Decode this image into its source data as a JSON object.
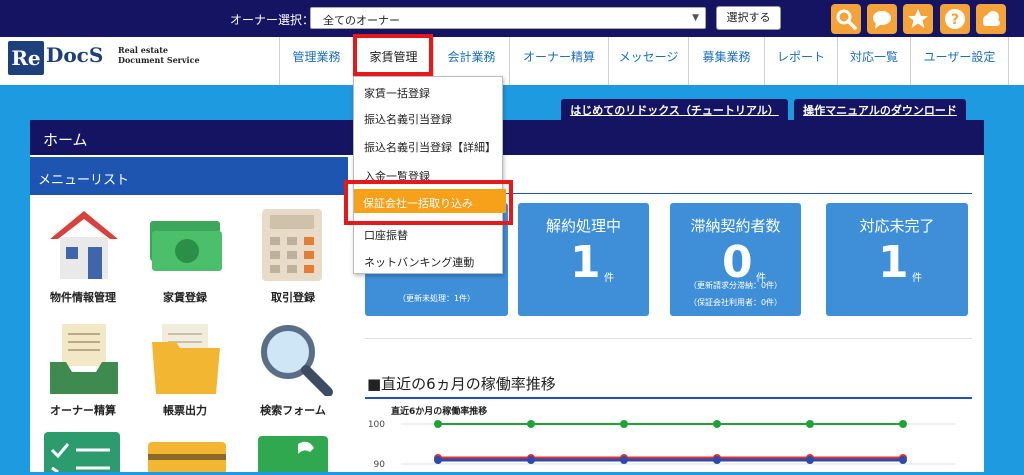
{
  "topbar": {
    "owner_label": "オーナー選択：",
    "owner_value": "全てのオーナー",
    "select_button": "選択する",
    "icons": [
      "search-icon",
      "chat-icon",
      "star-icon",
      "help-icon",
      "cloud-icon"
    ]
  },
  "logo": {
    "re": "Re",
    "docs": "DocS",
    "tagline_line1": "Real estate",
    "tagline_line2": "Document Service"
  },
  "nav": {
    "items": [
      "管理業務",
      "家賃管理",
      "会計業務",
      "オーナー精算",
      "メッセージ",
      "募集業務",
      "レポート",
      "対応一覧",
      "ユーザー設定"
    ],
    "active": "家賃管理"
  },
  "tabs": {
    "tutorial": "はじめてのリドックス（チュートリアル）",
    "manual": "操作マニュアルのダウンロード"
  },
  "panel": {
    "home_title": "ホーム",
    "menu_title": "メニューリスト"
  },
  "menu_tiles": [
    {
      "label": "物件情報管理",
      "icon": "house-icon"
    },
    {
      "label": "家賃登録",
      "icon": "money-icon"
    },
    {
      "label": "取引登録",
      "icon": "calculator-icon"
    },
    {
      "label": "オーナー精算",
      "icon": "inbox-tray-icon"
    },
    {
      "label": "帳票出力",
      "icon": "folder-icon"
    },
    {
      "label": "検索フォーム",
      "icon": "magnifier-icon"
    }
  ],
  "dropdown": {
    "items": [
      "家賃一括登録",
      "振込名義引当登録",
      "振込名義引当登録【詳細】",
      "入金一覧登録",
      "保証会社一括取り込み",
      "口座振替",
      "ネットバンキング連動"
    ],
    "selected": "保証会社一括取り込み"
  },
  "stats": {
    "card1": {
      "sub": "（更新未処理：1件）"
    },
    "card2": {
      "title": "解約処理中",
      "value": "1",
      "unit": "件"
    },
    "card3": {
      "title": "滞納契約者数",
      "value": "0",
      "unit": "件",
      "sub1": "（更新請求分滞納：0件）",
      "sub2": "（保証会社利用者：0件）"
    },
    "card4": {
      "title": "対応未完了",
      "value": "1",
      "unit": "件"
    }
  },
  "section": {
    "title": "■直近の6ヵ月の稼働率推移"
  },
  "colors": {
    "green": "#22a03a",
    "red": "#e0332f",
    "blue": "#2f4aa8",
    "accent": "#f7a01a"
  },
  "chart_data": {
    "type": "line",
    "title": "直近6か月の稼働率推移",
    "xlabel": "",
    "ylabel": "",
    "y_ticks": [
      100,
      90
    ],
    "ylim": [
      85,
      102
    ],
    "series": [
      {
        "values": [
          100,
          100,
          100,
          100,
          100,
          100
        ],
        "color": "#22a03a"
      },
      {
        "values": [
          91.5,
          91.5,
          91.5,
          91.5,
          91.5,
          91.5
        ],
        "color": "#e0332f"
      },
      {
        "values": [
          91,
          91,
          91,
          91,
          91,
          91
        ],
        "color": "#2f4aa8"
      }
    ]
  }
}
